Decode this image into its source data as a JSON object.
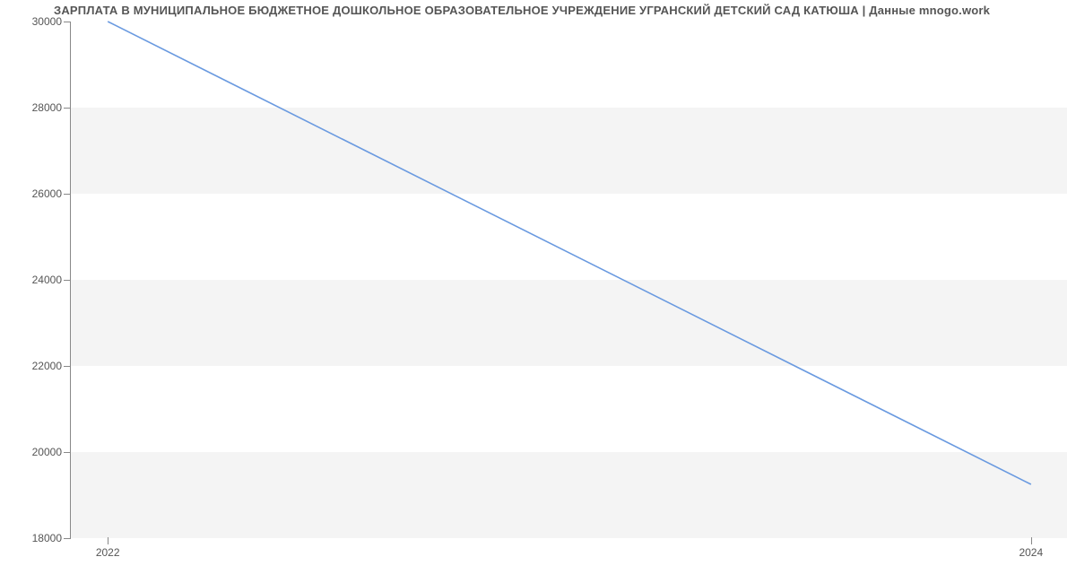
{
  "chart_data": {
    "type": "line",
    "title": "ЗАРПЛАТА В МУНИЦИПАЛЬНОЕ БЮДЖЕТНОЕ ДОШКОЛЬНОЕ ОБРАЗОВАТЕЛЬНОЕ УЧРЕЖДЕНИЕ УГРАНСКИЙ ДЕТСКИЙ САД КАТЮША | Данные mnogo.work",
    "x": [
      2022,
      2024
    ],
    "values": [
      30000,
      19250
    ],
    "xlabel": "",
    "ylabel": "",
    "xlim": [
      2021.92,
      2024.08
    ],
    "ylim": [
      18000,
      30000
    ],
    "y_ticks": [
      18000,
      20000,
      22000,
      24000,
      26000,
      28000,
      30000
    ],
    "y_tick_labels": [
      "18000",
      "20000",
      "22000",
      "24000",
      "26000",
      "28000",
      "30000"
    ],
    "x_ticks": [
      2022,
      2024
    ],
    "x_tick_labels": [
      "2022",
      "2024"
    ],
    "bands_between": [
      [
        18000,
        20000
      ],
      [
        22000,
        24000
      ],
      [
        26000,
        28000
      ]
    ],
    "line_color": "#6a9ae0"
  }
}
